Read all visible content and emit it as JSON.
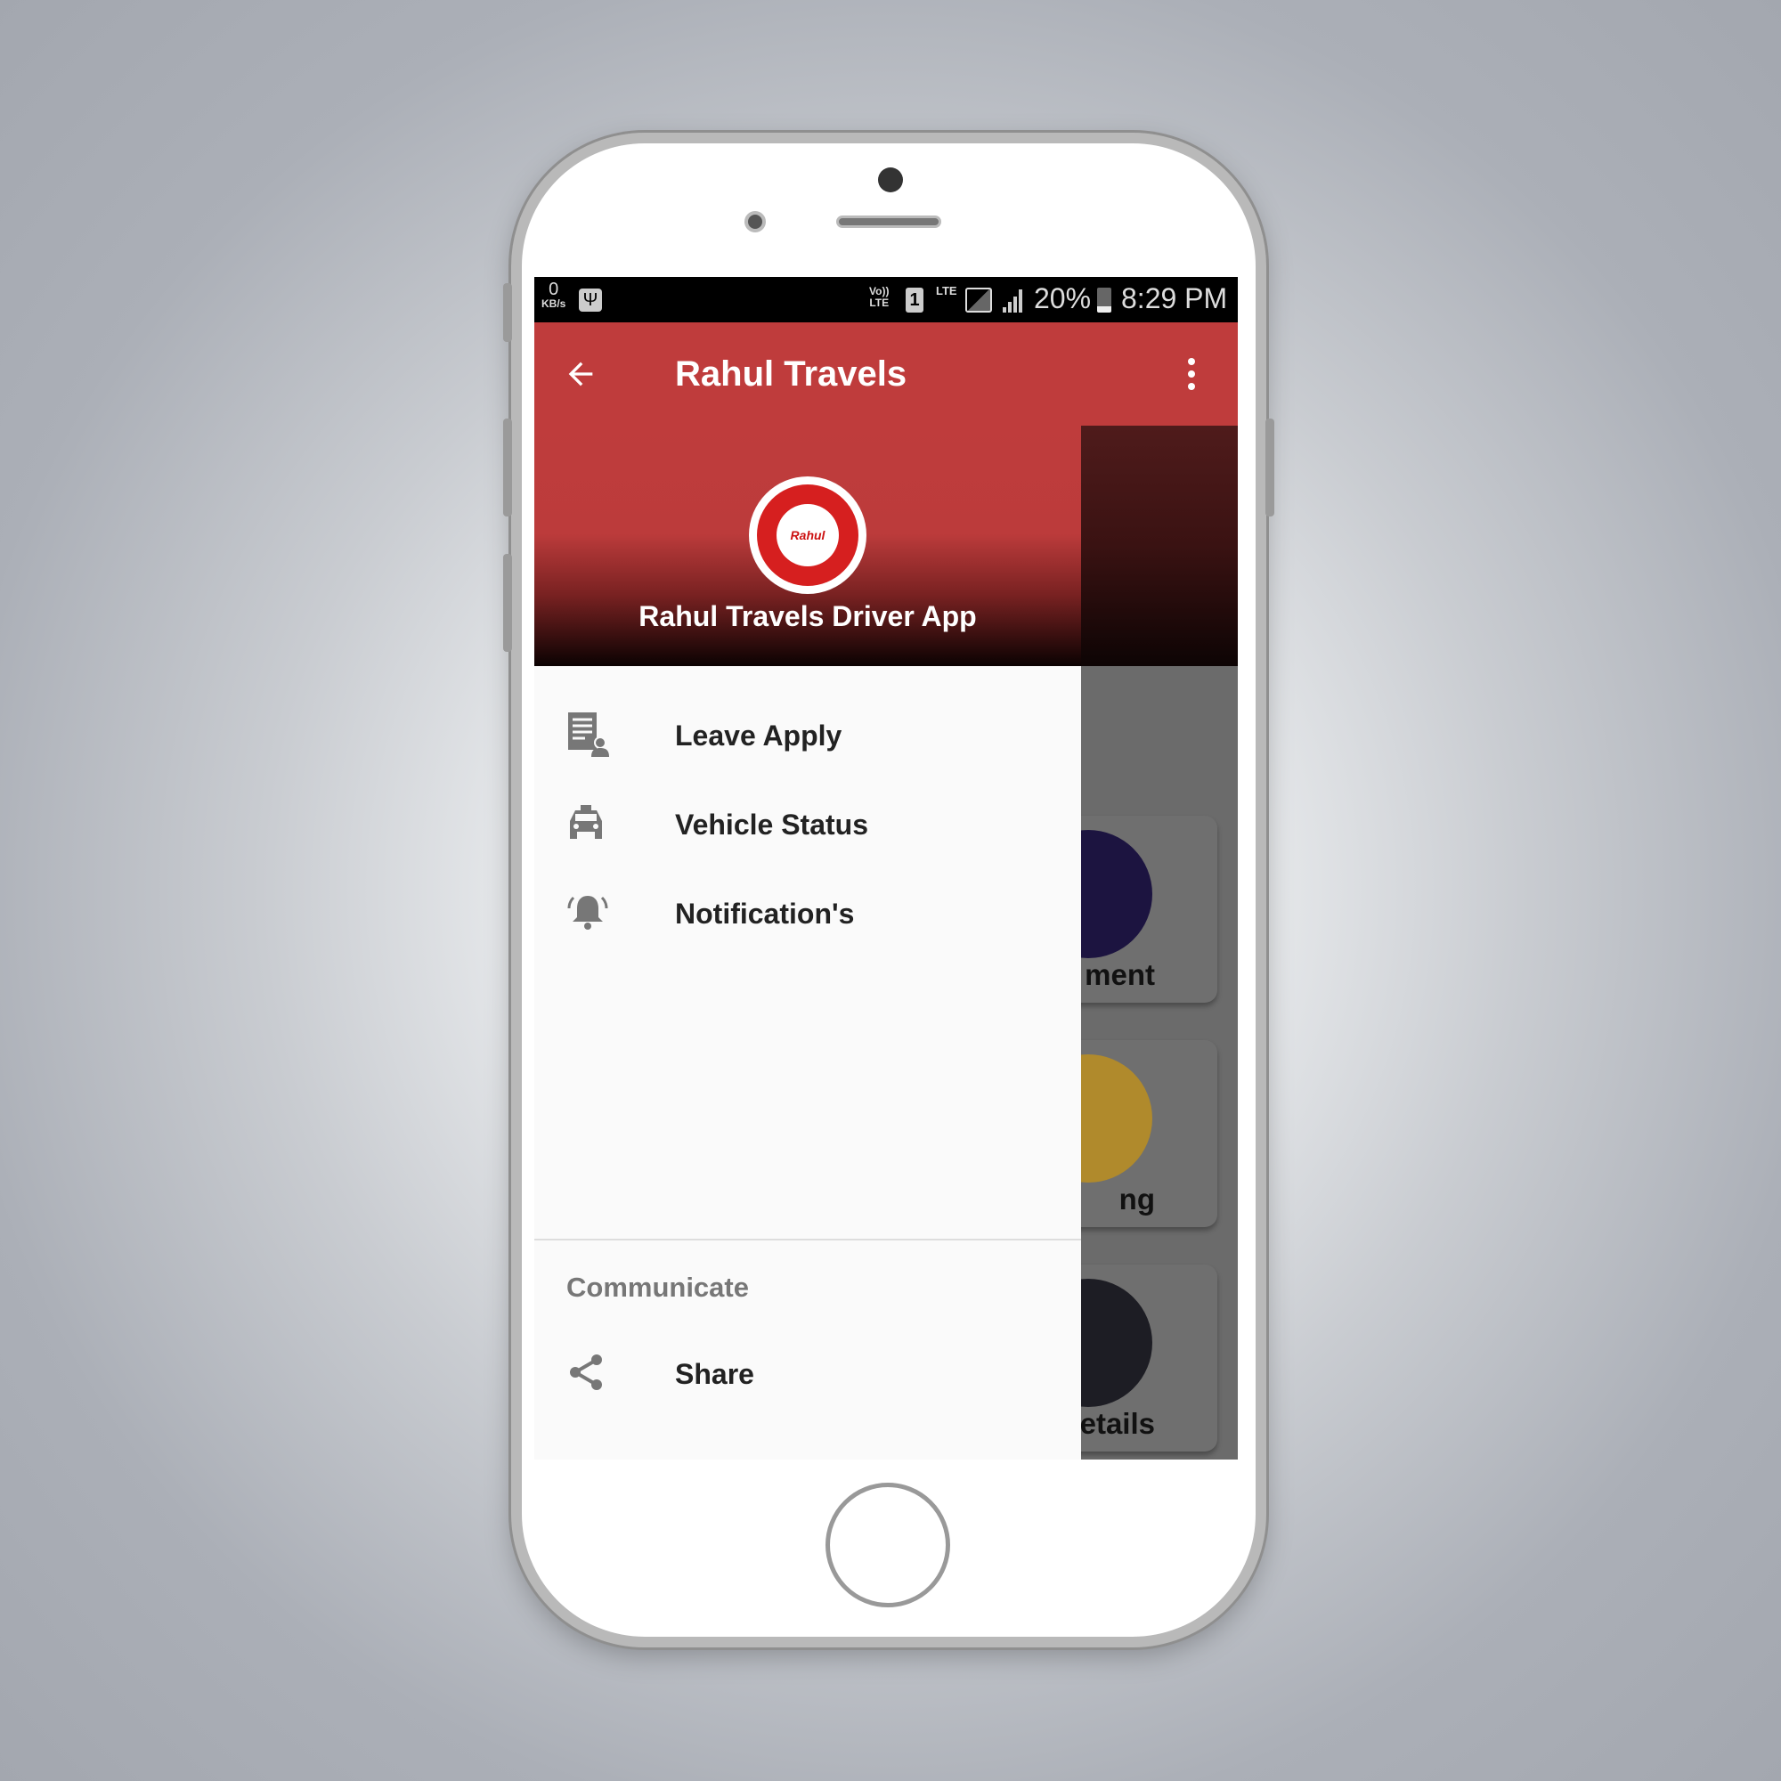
{
  "status_bar": {
    "speed": "0",
    "speed_unit": "KB/s",
    "volte": "Vo))",
    "volte_sub": "LTE",
    "sim": "1",
    "network": "LTE",
    "battery": "20%",
    "time": "8:29 PM"
  },
  "toolbar": {
    "title": "Rahul Travels",
    "back_icon": "arrow-left-icon",
    "menu_icon": "more-vert-icon"
  },
  "drawer": {
    "header": {
      "app_title": "Rahul Travels Driver App",
      "logo_text": "RAHUL TRAVELS DRIVER APP"
    },
    "items": [
      {
        "label": "Leave Apply",
        "icon": "document-person-icon"
      },
      {
        "label": "Vehicle Status",
        "icon": "taxi-icon"
      },
      {
        "label": "Notification's",
        "icon": "bell-icon"
      }
    ],
    "section": "Communicate",
    "section_items": [
      {
        "label": "Share",
        "icon": "share-icon"
      }
    ]
  },
  "background_cards": [
    {
      "label": "ment",
      "color": "#1c1440"
    },
    {
      "label": "ng",
      "color": "#d9a32a"
    },
    {
      "label": "etails",
      "color": "#1d1d24"
    }
  ],
  "colors": {
    "primary": "#bf3c3c"
  }
}
